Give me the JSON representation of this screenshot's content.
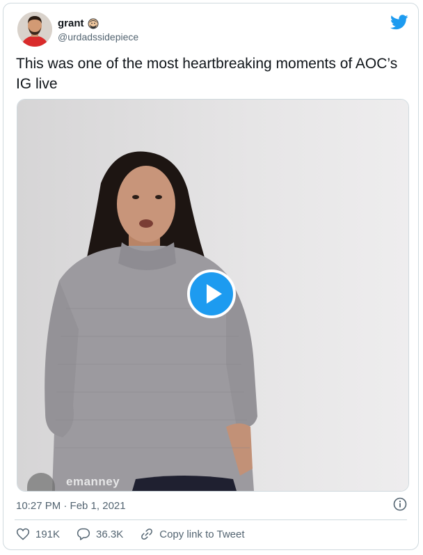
{
  "tweet": {
    "display_name": "grant",
    "handle": "@urdadssidepiece",
    "text": "This was one of the most heartbreaking moments of AOC’s IG live",
    "timestamp": "10:27 PM · Feb 1, 2021",
    "watermark": "emanney"
  },
  "actions": {
    "likes": "191K",
    "replies": "36.3K",
    "copy_link": "Copy link to Tweet"
  },
  "icons": {
    "brand": "twitter-bird-icon",
    "play": "play-icon",
    "info": "info-icon",
    "like": "heart-icon",
    "reply": "reply-icon",
    "link": "link-icon",
    "emoji": "bearded-face-emoji-icon"
  },
  "colors": {
    "accent": "#1d9bf0",
    "secondary_text": "#536471",
    "border": "#cfd9de"
  }
}
